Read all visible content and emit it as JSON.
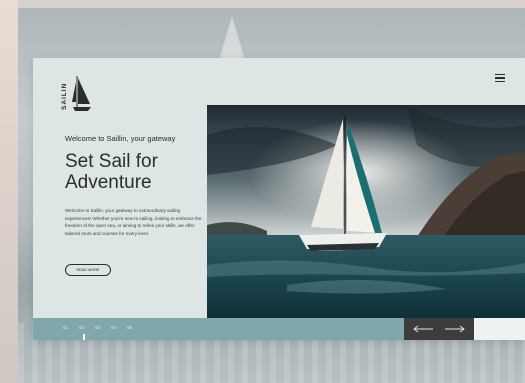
{
  "brand": {
    "name": "SAILIN"
  },
  "menu": {
    "icon": "hamburger-icon"
  },
  "hero": {
    "welcome": "Welcome to Saillin, your gateway",
    "title_line1": "Set Sail for",
    "title_line2": "Adventure",
    "description": "Welcome to Saillin, your gateway to extraordinary sailing experiences! Whether you're new to sailing, looking to embrace the freedom of the open sea, or aiming to refine your skills, we offer tailored tours and courses for every level.",
    "cta": "READ MORE"
  },
  "pager": {
    "items": [
      "01",
      "02",
      "03",
      "04",
      "05"
    ],
    "active_index": 1
  },
  "nav": {
    "prev_icon": "arrow-left-icon",
    "next_icon": "arrow-right-icon"
  },
  "colors": {
    "card": "#dde5e5",
    "bar": "#7fa7ac",
    "nav_box": "#3b3c3b",
    "text": "#2b2e30"
  }
}
